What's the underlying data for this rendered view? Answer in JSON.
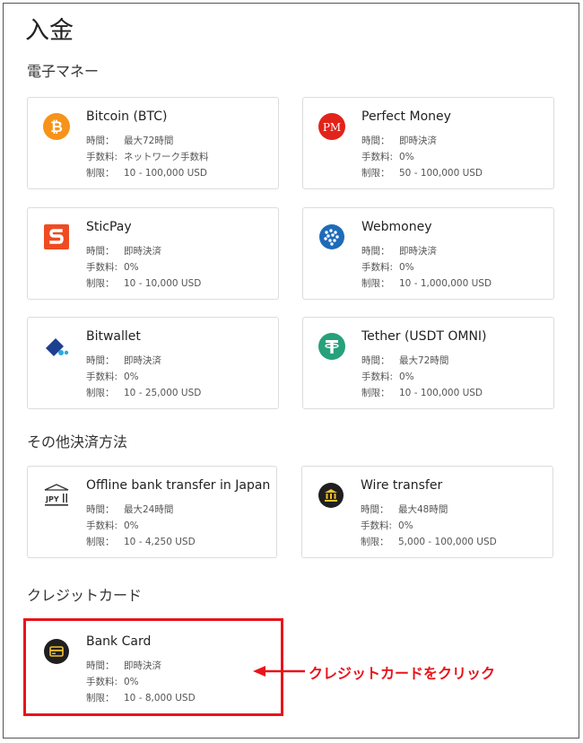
{
  "page": {
    "title": "入金"
  },
  "sections": {
    "emoney": "電子マネー",
    "other": "その他決済方法",
    "credit": "クレジットカード"
  },
  "labels": {
    "time": "時間：",
    "fee": "手数料:",
    "limit": "制限："
  },
  "methods": [
    {
      "name": "Bitcoin (BTC)",
      "time": "最大72時間",
      "fee": "ネットワーク手数料",
      "limit": "10 - 100,000 USD",
      "icon": "bitcoin-icon",
      "color": "#f7931a"
    },
    {
      "name": "Perfect Money",
      "time": "即時決済",
      "fee": "0%",
      "limit": "50 - 100,000 USD",
      "icon": "perfect-money-icon",
      "color": "#e2231a"
    },
    {
      "name": "SticPay",
      "time": "即時決済",
      "fee": "0%",
      "limit": "10 - 10,000 USD",
      "icon": "sticpay-icon",
      "color": "#ef4b23"
    },
    {
      "name": "Webmoney",
      "time": "即時決済",
      "fee": "0%",
      "limit": "10 - 1,000,000 USD",
      "icon": "webmoney-icon",
      "color": "#1e6bb8"
    },
    {
      "name": "Bitwallet",
      "time": "即時決済",
      "fee": "0%",
      "limit": "10 - 25,000 USD",
      "icon": "bitwallet-icon",
      "color": "#1d3f8f"
    },
    {
      "name": "Tether (USDT OMNI)",
      "time": "最大72時間",
      "fee": "0%",
      "limit": "10 - 100,000 USD",
      "icon": "tether-icon",
      "color": "#26a17b"
    },
    {
      "name": "Offline bank transfer in Japan",
      "time": "最大24時間",
      "fee": "0%",
      "limit": "10 - 4,250 USD",
      "icon": "jpy-bank-icon",
      "color": "#333333"
    },
    {
      "name": "Wire transfer",
      "time": "最大48時間",
      "fee": "0%",
      "limit": "5,000 - 100,000 USD",
      "icon": "bank-icon",
      "color": "#1f1f1f"
    },
    {
      "name": "Bank Card",
      "time": "即時決済",
      "fee": "0%",
      "limit": "10 - 8,000 USD",
      "icon": "credit-card-icon",
      "color": "#1f1f1f"
    }
  ],
  "logo_text": {
    "perfect_money": "PM",
    "jpy": "JPY"
  },
  "annotation": {
    "text": "クレジットカードをクリック",
    "color": "#e8141a"
  }
}
